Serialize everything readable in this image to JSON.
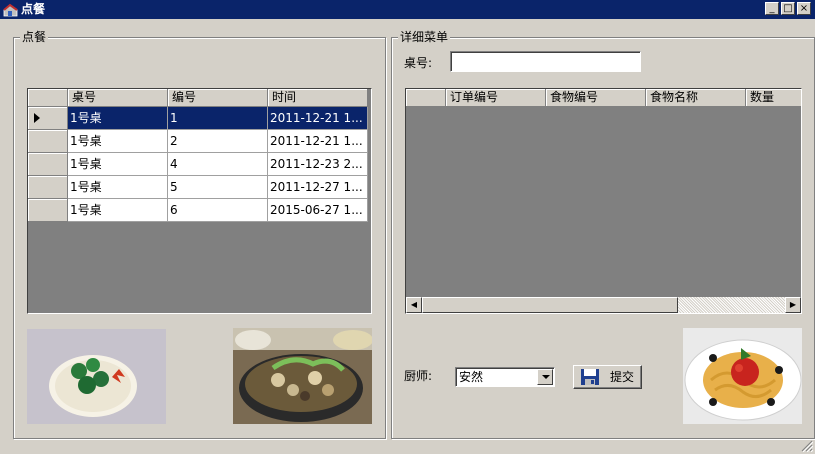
{
  "window": {
    "title": "点餐",
    "controls": [
      "_",
      "□",
      "×"
    ]
  },
  "left_group": {
    "legend": "点餐",
    "columns": [
      "桌号",
      "编号",
      "时间"
    ],
    "rows": [
      {
        "table": "1号桌",
        "id": "1",
        "time": "2011-12-21 1..."
      },
      {
        "table": "1号桌",
        "id": "2",
        "time": "2011-12-21 1..."
      },
      {
        "table": "1号桌",
        "id": "4",
        "time": "2011-12-23 2..."
      },
      {
        "table": "1号桌",
        "id": "5",
        "time": "2011-12-27 1..."
      },
      {
        "table": "1号桌",
        "id": "6",
        "time": "2015-06-27 1..."
      }
    ]
  },
  "right_group": {
    "legend": "详细菜单",
    "table_no_label": "桌号:",
    "table_no_value": "",
    "columns": [
      "订单编号",
      "食物编号",
      "食物名称",
      "数量"
    ],
    "chef_label": "厨师:",
    "chef_value": "安然",
    "submit_label": "提交"
  },
  "colors": {
    "titlebar": "#0a246a",
    "selection": "#0a246a",
    "window_bg": "#d4d0c8",
    "grid_empty": "#808080"
  }
}
